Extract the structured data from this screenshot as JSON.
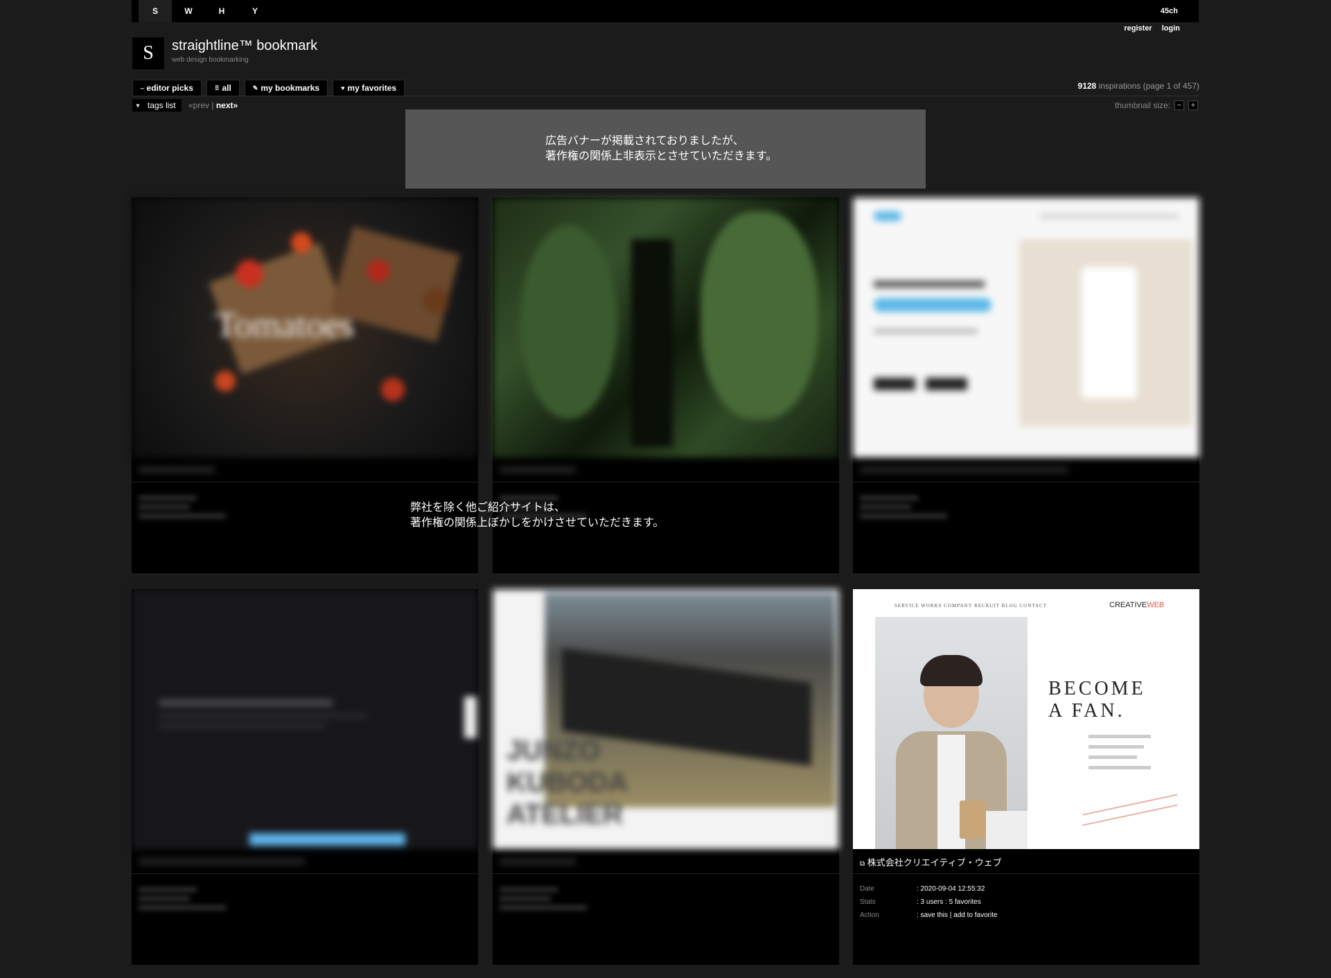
{
  "topnav": {
    "items": [
      "S",
      "W",
      "H",
      "Y"
    ],
    "right_link": "45ch"
  },
  "auth": {
    "register": "register",
    "login": "login"
  },
  "logo": {
    "letter": "S",
    "title": "straightline™  bookmark",
    "subtitle": "web design bookmarking"
  },
  "toolbar": {
    "buttons": [
      {
        "label": "editor picks",
        "icon": "editor-icon"
      },
      {
        "label": "all",
        "icon": "grid-icon"
      },
      {
        "label": "my bookmarks",
        "icon": "pencil-icon"
      },
      {
        "label": "my favorites",
        "icon": "heart-icon"
      }
    ],
    "count_number": "9128",
    "count_text": " inspirations (page 1 of 457)"
  },
  "subbar": {
    "tags_label": "tags list",
    "prev": "«prev",
    "next": "next»",
    "pager_sep": "|",
    "thumb_size_label": "thumbnail size:",
    "minus": "−",
    "plus": "+"
  },
  "banner": {
    "line1": "広告バナーが掲載されておりましたが、",
    "line2": "著作権の関係上非表示とさせていただきます。"
  },
  "overlay_note": {
    "line1": "弊社を除く他ご紹介サイトは、",
    "line2": "著作権の関係上ぼかしをかけさせていただきます。"
  },
  "cards": [
    {
      "title": "",
      "thumb_text": "Tomatoes"
    },
    {
      "title": "",
      "thumb_text": ""
    },
    {
      "title": "",
      "thumb_text": ""
    },
    {
      "title": "",
      "thumb_text": ""
    },
    {
      "title": "",
      "thumb_text": "JUNZO KUBODA ATELIER"
    },
    {
      "title": "株式会社クリエイティブ・ウェブ",
      "meta": {
        "date_label": "Date",
        "date_value": ": 2020-09-04 12:55:32",
        "stats_label": "Stats",
        "stats_value": ": 3 users : 5 favorites",
        "action_label": "Action",
        "action_prefix": ": ",
        "save_label": "save this",
        "sep": " | ",
        "fav_label": "add to favorite"
      },
      "thumb": {
        "nav": "SERVICE   WORKS   COMPANY   RECRUIT   BLOG   CONTACT",
        "brand": "CREATIVE",
        "brand_web": "WEB",
        "headline1": "BECOME",
        "headline2": "A FAN."
      }
    }
  ],
  "colors": {
    "page_bg": "#1b1b1b",
    "bar_bg": "#000000",
    "banner_bg": "#565656"
  }
}
